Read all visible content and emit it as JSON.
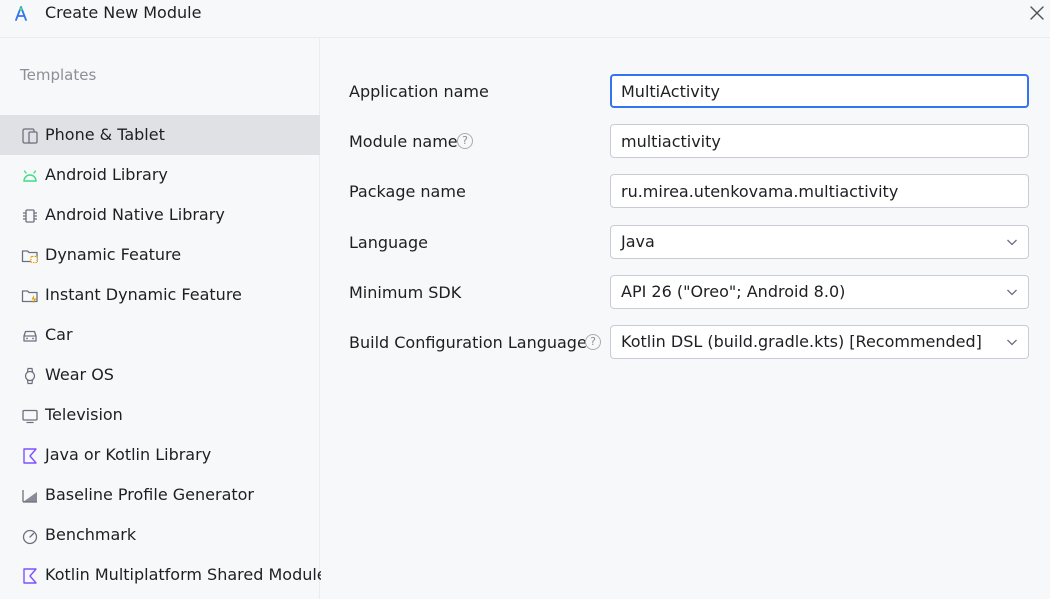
{
  "window": {
    "title": "Create New Module",
    "app_icon": "android-studio-icon",
    "close_icon": "close-icon"
  },
  "sidebar": {
    "header": "Templates",
    "items": [
      {
        "label": "Phone & Tablet",
        "icon": "phone-tablet-icon",
        "selected": true
      },
      {
        "label": "Android Library",
        "icon": "android-icon"
      },
      {
        "label": "Android Native Library",
        "icon": "chip-icon"
      },
      {
        "label": "Dynamic Feature",
        "icon": "folder-feature-icon"
      },
      {
        "label": "Instant Dynamic Feature",
        "icon": "folder-lightning-icon"
      },
      {
        "label": "Car",
        "icon": "car-icon"
      },
      {
        "label": "Wear OS",
        "icon": "watch-icon"
      },
      {
        "label": "Television",
        "icon": "tv-icon"
      },
      {
        "label": "Java or Kotlin Library",
        "icon": "kotlin-icon"
      },
      {
        "label": "Baseline Profile Generator",
        "icon": "baseline-profile-icon"
      },
      {
        "label": "Benchmark",
        "icon": "gauge-icon"
      },
      {
        "label": "Kotlin Multiplatform Shared Module",
        "icon": "kotlin-icon"
      }
    ]
  },
  "form": {
    "application_name": {
      "label": "Application name",
      "value": "MultiActivity"
    },
    "module_name": {
      "label": "Module name",
      "value": "multiactivity",
      "help": "?"
    },
    "package_name": {
      "label": "Package name",
      "value": "ru.mirea.utenkovama.multiactivity"
    },
    "language": {
      "label": "Language",
      "value": "Java"
    },
    "minimum_sdk": {
      "label": "Minimum SDK",
      "value": "API 26 (\"Oreo\"; Android 8.0)"
    },
    "build_config_language": {
      "label": "Build Configuration Language",
      "value": "Kotlin DSL (build.gradle.kts) [Recommended]",
      "help": "?"
    }
  },
  "colors": {
    "accent": "#3574f0",
    "selection": "#dfe1e5",
    "kotlin": "#7f52ff",
    "android": "#3ddc84"
  }
}
